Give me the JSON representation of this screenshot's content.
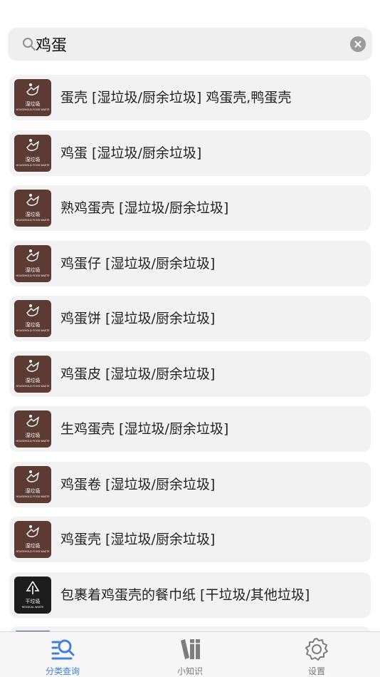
{
  "search": {
    "value": "鸡蛋",
    "placeholder": ""
  },
  "results": [
    {
      "text": "蛋壳 [湿垃圾/厨余垃圾] 鸡蛋壳,鸭蛋壳",
      "badge_cn": "湿垃圾",
      "badge_en": "HOUSEHOLD FOOD WASTE"
    },
    {
      "text": "鸡蛋 [湿垃圾/厨余垃圾]",
      "badge_cn": "湿垃圾",
      "badge_en": "HOUSEHOLD FOOD WASTE"
    },
    {
      "text": "熟鸡蛋壳 [湿垃圾/厨余垃圾]",
      "badge_cn": "湿垃圾",
      "badge_en": "HOUSEHOLD FOOD WASTE"
    },
    {
      "text": "鸡蛋仔 [湿垃圾/厨余垃圾]",
      "badge_cn": "湿垃圾",
      "badge_en": "HOUSEHOLD FOOD WASTE"
    },
    {
      "text": "鸡蛋饼 [湿垃圾/厨余垃圾]",
      "badge_cn": "湿垃圾",
      "badge_en": "HOUSEHOLD FOOD WASTE"
    },
    {
      "text": "鸡蛋皮 [湿垃圾/厨余垃圾]",
      "badge_cn": "湿垃圾",
      "badge_en": "HOUSEHOLD FOOD WASTE"
    },
    {
      "text": "生鸡蛋壳 [湿垃圾/厨余垃圾]",
      "badge_cn": "湿垃圾",
      "badge_en": "HOUSEHOLD FOOD WASTE"
    },
    {
      "text": "鸡蛋卷 [湿垃圾/厨余垃圾]",
      "badge_cn": "湿垃圾",
      "badge_en": "HOUSEHOLD FOOD WASTE"
    },
    {
      "text": "鸡蛋壳 [湿垃圾/厨余垃圾]",
      "badge_cn": "湿垃圾",
      "badge_en": "HOUSEHOLD FOOD WASTE"
    },
    {
      "text": "包裹着鸡蛋壳的餐巾纸 [干垃圾/其他垃圾]",
      "badge_cn": "干垃圾",
      "badge_en": "RESIDUAL WASTE"
    }
  ],
  "tabbar": {
    "tabs": [
      {
        "label": "分类查询",
        "icon": "search-list-icon",
        "active": true
      },
      {
        "label": "小知识",
        "icon": "books-icon",
        "active": false
      },
      {
        "label": "设置",
        "icon": "gear-icon",
        "active": false
      }
    ]
  },
  "colors": {
    "wet_waste": "#5c3b32",
    "dry_waste": "#1c1c1c",
    "accent": "#3f7fde"
  }
}
